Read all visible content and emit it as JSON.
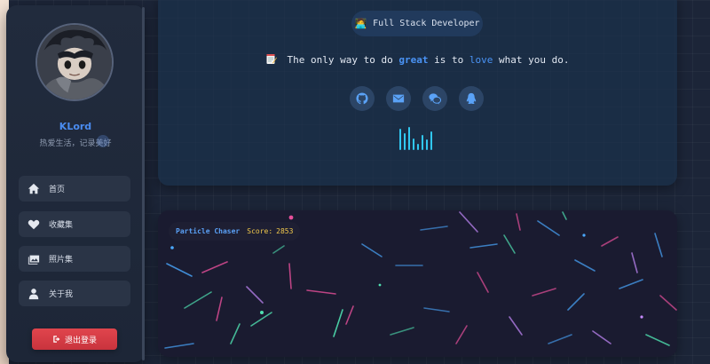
{
  "profile": {
    "name": "KLord",
    "motto": "热爱生活，记录美好"
  },
  "nav": [
    {
      "label": "首页",
      "icon": "home-icon"
    },
    {
      "label": "收藏集",
      "icon": "heart-icon"
    },
    {
      "label": "照片集",
      "icon": "photos-icon"
    },
    {
      "label": "关于我",
      "icon": "user-icon"
    }
  ],
  "logout_label": "退出登录",
  "hero": {
    "role": "Full Stack Developer",
    "role_emoji": "🧑‍💻",
    "quote": {
      "p1": "The only way to do ",
      "h1": "great",
      "p2": " is to ",
      "h2": "love",
      "p3": " what you do."
    },
    "socials": [
      "github-icon",
      "mail-icon",
      "wechat-icon",
      "qq-icon"
    ]
  },
  "game": {
    "title": "Particle Chaser",
    "score_label": "Score:",
    "score": "2853"
  },
  "colors": {
    "accent": "#4a8cf0",
    "score": "#f2c94c",
    "logout": "#d63a43",
    "equalizer": "#31c7f0"
  }
}
